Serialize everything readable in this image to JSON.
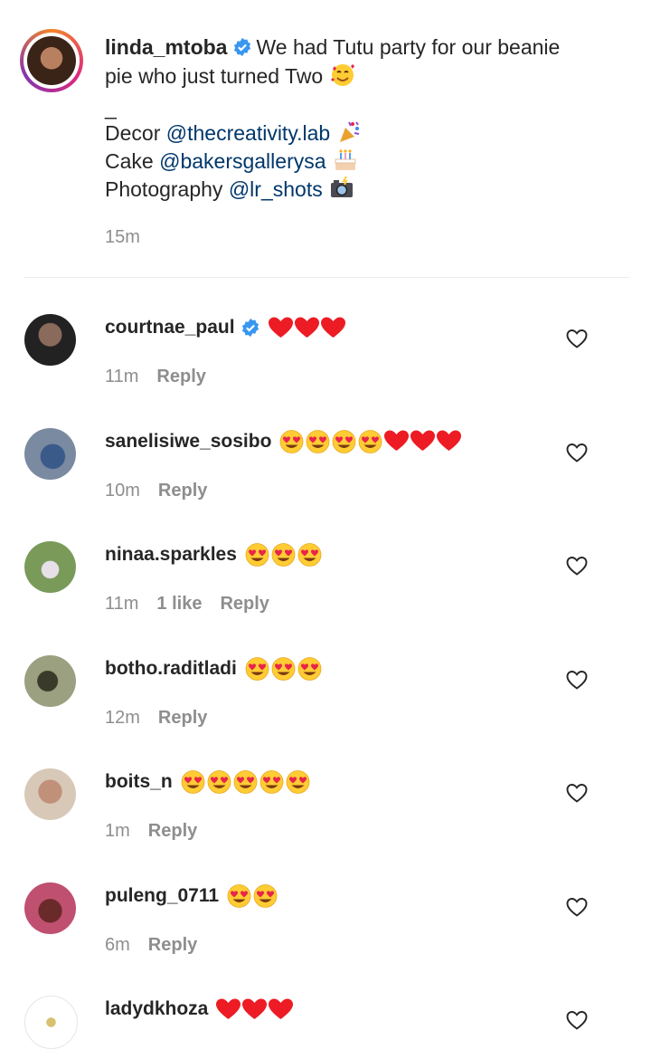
{
  "post": {
    "username": "linda_mtoba",
    "caption_line1": "We had Tutu party for our beanie",
    "caption_line2": "pie who just turned Two",
    "separator": "_",
    "decor_label": "Decor",
    "decor_handle": "@thecreativity.lab",
    "cake_label": "Cake",
    "cake_handle": "@bakersgallerysa",
    "photo_label": "Photography",
    "photo_handle": "@lr_shots",
    "time": "15m",
    "emojis": [
      "smiling-face-with-hearts",
      "party-popper",
      "birthday-cake",
      "camera-with-flash"
    ]
  },
  "comments": [
    {
      "username": "courtnae_paul",
      "verified": true,
      "emojis": "❤️❤️❤️",
      "time": "11m",
      "likes": "",
      "reply": "Reply"
    },
    {
      "username": "sanelisiwe_sosibo",
      "verified": false,
      "emojis": "😍😍😍😍❤️❤️❤️",
      "time": "10m",
      "likes": "",
      "reply": "Reply"
    },
    {
      "username": "ninaa.sparkles",
      "verified": false,
      "emojis": "😍😍😍",
      "time": "11m",
      "likes": "1 like",
      "reply": "Reply"
    },
    {
      "username": "botho.raditladi",
      "verified": false,
      "emojis": "😍😍😍",
      "time": "12m",
      "likes": "",
      "reply": "Reply"
    },
    {
      "username": "boits_n",
      "verified": false,
      "emojis": "😍😍😍😍😍",
      "time": "1m",
      "likes": "",
      "reply": "Reply"
    },
    {
      "username": "puleng_0711",
      "verified": false,
      "emojis": "😍😍",
      "time": "6m",
      "likes": "",
      "reply": "Reply"
    },
    {
      "username": "ladydkhoza",
      "verified": false,
      "emojis": "❤️❤️❤️",
      "time": "",
      "likes": "",
      "reply": ""
    }
  ],
  "colors": {
    "verified": "#3897f0",
    "mention": "#00376b",
    "meta": "#8e8e8e",
    "heart": "#ed1c24",
    "heart_eyes_face": "#ffcc33"
  }
}
